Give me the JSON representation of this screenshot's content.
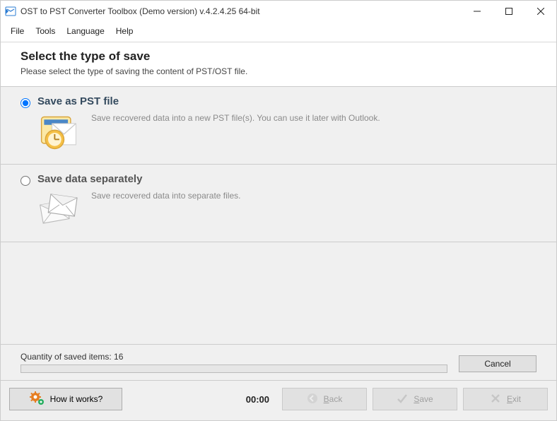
{
  "window": {
    "title": "OST to PST Converter Toolbox (Demo version) v.4.2.4.25 64-bit"
  },
  "menubar": {
    "file": "File",
    "tools": "Tools",
    "language": "Language",
    "help": "Help"
  },
  "header": {
    "title": "Select the type of save",
    "subtitle": "Please select the type of saving the content of PST/OST file."
  },
  "options": {
    "pst": {
      "title": "Save as PST file",
      "desc": "Save recovered data into a new PST file(s). You can use it later with Outlook."
    },
    "sep": {
      "title": "Save data separately",
      "desc": "Save recovered data into separate files."
    }
  },
  "progress": {
    "label": "Quantity of saved items: 16",
    "cancel": "Cancel"
  },
  "footer": {
    "how": "How it works?",
    "timer": "00:00",
    "back": "Back",
    "save": "Save",
    "exit": "Exit"
  }
}
